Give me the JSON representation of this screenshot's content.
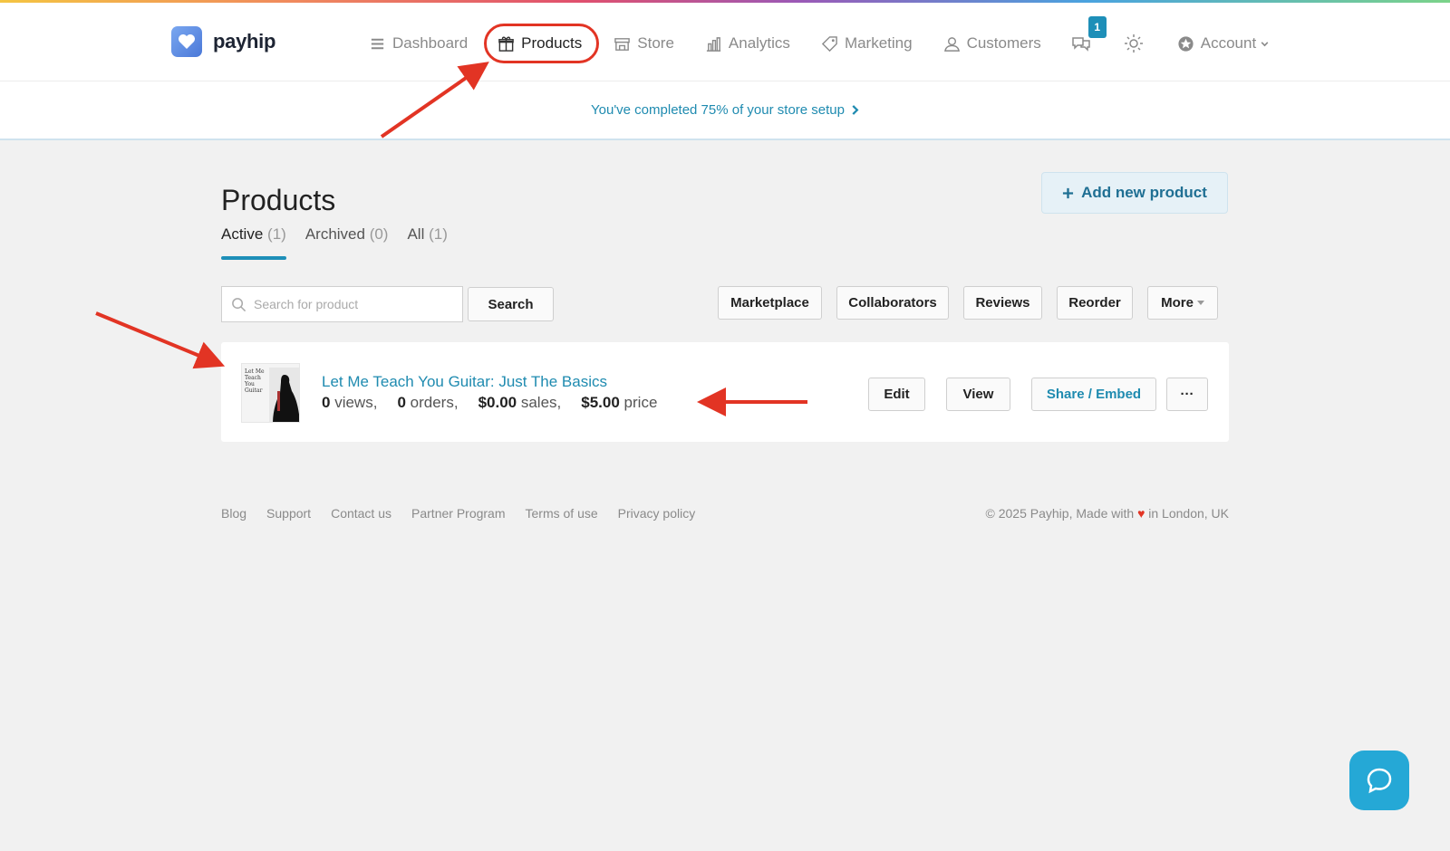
{
  "brand": {
    "name": "payhip"
  },
  "nav": {
    "dashboard": "Dashboard",
    "products": "Products",
    "store": "Store",
    "analytics": "Analytics",
    "marketing": "Marketing",
    "customers": "Customers",
    "messages_badge": "1",
    "account": "Account"
  },
  "setup": {
    "text": "You've completed 75% of your store setup"
  },
  "page": {
    "title": "Products",
    "add_button": "Add new product",
    "tabs": [
      {
        "label": "Active",
        "count": "(1)"
      },
      {
        "label": "Archived",
        "count": "(0)"
      },
      {
        "label": "All",
        "count": "(1)"
      }
    ]
  },
  "toolbar": {
    "search_placeholder": "Search for product",
    "search_button": "Search",
    "marketplace": "Marketplace",
    "collaborators": "Collaborators",
    "reviews": "Reviews",
    "reorder": "Reorder",
    "more": "More"
  },
  "product": {
    "thumb_title": "Let Me Teach You Guitar",
    "name": "Let Me Teach You Guitar: Just The Basics",
    "views_value": "0",
    "views_label": "views,",
    "orders_value": "0",
    "orders_label": "orders,",
    "sales_value": "$0.00",
    "sales_label": "sales,",
    "price_value": "$5.00",
    "price_label": "price",
    "edit": "Edit",
    "view": "View",
    "share": "Share / Embed",
    "more": "···"
  },
  "footer": {
    "links": [
      "Blog",
      "Support",
      "Contact us",
      "Partner Program",
      "Terms of use",
      "Privacy policy"
    ],
    "copyright_pre": "© 2025 Payhip, Made with",
    "copyright_post": "in London, UK"
  },
  "colors": {
    "accent": "#1f8bb0",
    "annotation": "#e23424",
    "chat": "#25a8d6"
  }
}
